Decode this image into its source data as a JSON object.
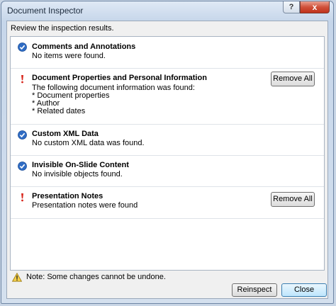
{
  "window": {
    "title": "Document Inspector",
    "help_glyph": "?",
    "close_glyph": "x"
  },
  "intro": "Review the inspection results.",
  "items": [
    {
      "status": "ok",
      "title": "Comments and Annotations",
      "desc": [
        "No items were found."
      ],
      "button": ""
    },
    {
      "status": "warning",
      "title": "Document Properties and Personal Information",
      "desc": [
        "The following document information was found:",
        "* Document properties",
        "* Author",
        "* Related dates"
      ],
      "button": "Remove All"
    },
    {
      "status": "ok",
      "title": "Custom XML Data",
      "desc": [
        "No custom XML data was found."
      ],
      "button": ""
    },
    {
      "status": "ok",
      "title": "Invisible On-Slide Content",
      "desc": [
        "No invisible objects found."
      ],
      "button": ""
    },
    {
      "status": "warning",
      "title": "Presentation Notes",
      "desc": [
        "Presentation notes were found"
      ],
      "button": "Remove All"
    }
  ],
  "note": "Note: Some changes cannot be undone.",
  "footer": {
    "reinspect_label": "Reinspect",
    "close_label": "Close"
  },
  "icons": {
    "ok": "check-circle-icon",
    "warning": "exclamation-icon",
    "note": "warning-triangle-icon"
  },
  "colors": {
    "ok_blue": "#2f6cc4",
    "warning_red": "#d8261c",
    "titlebar_close": "#c0321c"
  }
}
